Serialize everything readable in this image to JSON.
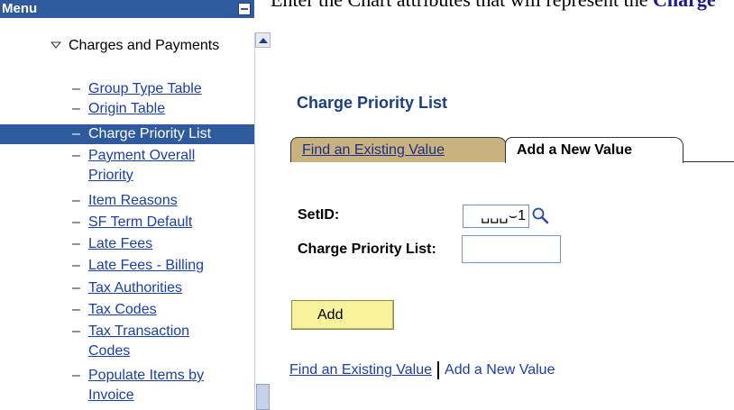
{
  "top_caption": {
    "text_plain": "Enter the Chart attributes that will represent the ",
    "text_bold": "Charge"
  },
  "menu": {
    "title": "Menu",
    "section": "Charges and Payments",
    "items": [
      {
        "label": "Group Type Table"
      },
      {
        "label": "Origin Table"
      },
      {
        "label": "Charge Priority List",
        "selected": true
      },
      {
        "label": "Payment Overall Priority"
      },
      {
        "label": "Item Reasons"
      },
      {
        "label": "SF Term Default"
      },
      {
        "label": "Late Fees"
      },
      {
        "label": "Late Fees - Billing"
      },
      {
        "label": "Tax Authorities"
      },
      {
        "label": "Tax Codes"
      },
      {
        "label": "Tax Transaction Codes"
      },
      {
        "label": "Populate Items by Invoice"
      }
    ]
  },
  "page": {
    "title": "Charge Priority List",
    "tabs": [
      {
        "label": "Find an Existing Value"
      },
      {
        "label": "Add a New Value"
      }
    ],
    "fields": {
      "setid_label": "SetID:",
      "setid_value": "␣␣␣⌣1",
      "charge_priority_label": "Charge Priority List:",
      "charge_priority_value": ""
    },
    "add_button": "Add",
    "links": {
      "find": "Find an Existing Value",
      "add": "Add a New Value"
    }
  },
  "icons": {
    "lookup": "magnifier-icon",
    "collapse": "minus-icon",
    "section_toggle": "triangle-down-icon",
    "scroll_up": "chevron-up-icon"
  },
  "colors": {
    "menu_header": "#2f5a9e",
    "selected_item": "#2f5a9e",
    "link": "#1a3fa8",
    "title": "#1a3f87",
    "tab_inactive": "#c9b27f",
    "add_button": "#f7f29b"
  }
}
